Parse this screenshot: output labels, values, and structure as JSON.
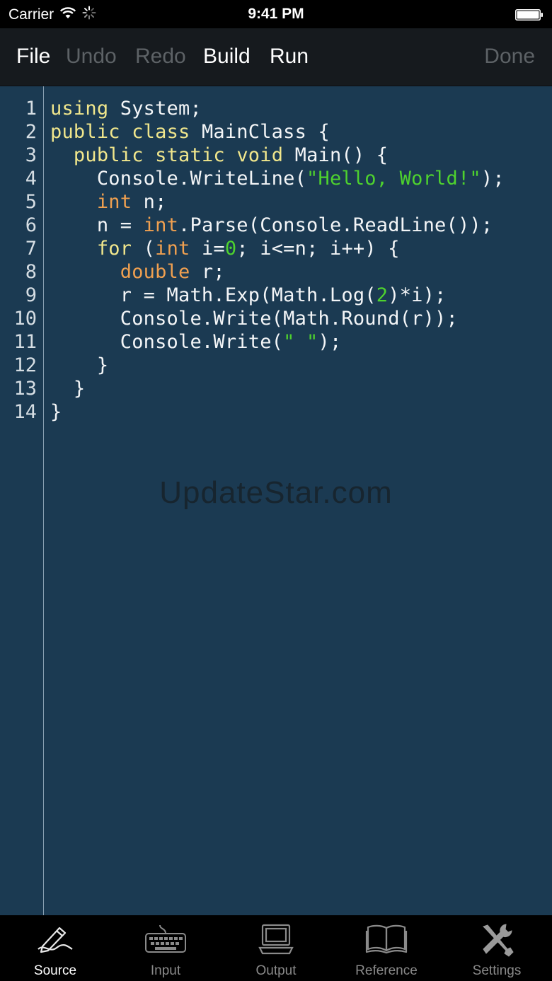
{
  "status": {
    "carrier": "Carrier",
    "time": "9:41 PM"
  },
  "toolbar": {
    "file": "File",
    "undo": "Undo",
    "redo": "Redo",
    "build": "Build",
    "run": "Run",
    "done": "Done"
  },
  "editor": {
    "line_numbers": [
      "1",
      "2",
      "3",
      "4",
      "5",
      "6",
      "7",
      "8",
      "9",
      "10",
      "11",
      "12",
      "13",
      "14"
    ],
    "lines": [
      [
        {
          "t": "kw",
          "s": "using"
        },
        {
          "t": "plain",
          "s": " System;"
        }
      ],
      [
        {
          "t": "kw",
          "s": "public"
        },
        {
          "t": "plain",
          "s": " "
        },
        {
          "t": "kw",
          "s": "class"
        },
        {
          "t": "plain",
          "s": " MainClass {"
        }
      ],
      [
        {
          "t": "plain",
          "s": "  "
        },
        {
          "t": "kw",
          "s": "public"
        },
        {
          "t": "plain",
          "s": " "
        },
        {
          "t": "kw",
          "s": "static"
        },
        {
          "t": "plain",
          "s": " "
        },
        {
          "t": "kw",
          "s": "void"
        },
        {
          "t": "plain",
          "s": " Main() {"
        }
      ],
      [
        {
          "t": "plain",
          "s": "    Console.WriteLine("
        },
        {
          "t": "str",
          "s": "\"Hello, World!\""
        },
        {
          "t": "plain",
          "s": ");"
        }
      ],
      [
        {
          "t": "plain",
          "s": "    "
        },
        {
          "t": "type",
          "s": "int"
        },
        {
          "t": "plain",
          "s": " n;"
        }
      ],
      [
        {
          "t": "plain",
          "s": "    n = "
        },
        {
          "t": "type",
          "s": "int"
        },
        {
          "t": "plain",
          "s": ".Parse(Console.ReadLine());"
        }
      ],
      [
        {
          "t": "plain",
          "s": "    "
        },
        {
          "t": "kw",
          "s": "for"
        },
        {
          "t": "plain",
          "s": " ("
        },
        {
          "t": "type",
          "s": "int"
        },
        {
          "t": "plain",
          "s": " i="
        },
        {
          "t": "num",
          "s": "0"
        },
        {
          "t": "plain",
          "s": "; i<=n; i++) {"
        }
      ],
      [
        {
          "t": "plain",
          "s": "      "
        },
        {
          "t": "type",
          "s": "double"
        },
        {
          "t": "plain",
          "s": " r;"
        }
      ],
      [
        {
          "t": "plain",
          "s": "      r = Math.Exp(Math.Log("
        },
        {
          "t": "num",
          "s": "2"
        },
        {
          "t": "plain",
          "s": ")*i);"
        }
      ],
      [
        {
          "t": "plain",
          "s": "      Console.Write(Math.Round(r));"
        }
      ],
      [
        {
          "t": "plain",
          "s": "      Console.Write("
        },
        {
          "t": "str",
          "s": "\" \""
        },
        {
          "t": "plain",
          "s": ");"
        }
      ],
      [
        {
          "t": "plain",
          "s": "    }"
        }
      ],
      [
        {
          "t": "plain",
          "s": "  }"
        }
      ],
      [
        {
          "t": "plain",
          "s": "}"
        }
      ]
    ],
    "colors": {
      "keyword": "#f0e68c",
      "type": "#f0a050",
      "string": "#4ed22e",
      "number": "#4ed22e",
      "background": "#1b3a52"
    }
  },
  "watermark": "UpdateStar.com",
  "tabs": [
    {
      "label": "Source",
      "icon": "pen-icon",
      "active": true
    },
    {
      "label": "Input",
      "icon": "keyboard-icon",
      "active": false
    },
    {
      "label": "Output",
      "icon": "monitor-icon",
      "active": false
    },
    {
      "label": "Reference",
      "icon": "book-icon",
      "active": false
    },
    {
      "label": "Settings",
      "icon": "tools-icon",
      "active": false
    }
  ]
}
